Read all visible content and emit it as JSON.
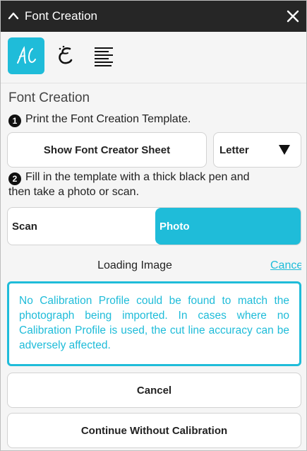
{
  "window": {
    "title": "Font Creation",
    "collapse_icon": "chevron-up-icon",
    "close_icon": "close-icon"
  },
  "tools": [
    {
      "name": "handwriting-tool-icon",
      "active": true
    },
    {
      "name": "calligraphy-tool-icon",
      "active": false
    },
    {
      "name": "text-align-tool-icon",
      "active": false
    }
  ],
  "section_title": "Font Creation",
  "step1": {
    "number": "1",
    "text": "Print the Font Creation Template."
  },
  "show_sheet_label": "Show Font Creator Sheet",
  "paper_size": {
    "selected": "Letter"
  },
  "step2": {
    "number": "2",
    "line1": "Fill in the template with a thick black pen and",
    "line2": "then take a photo or scan."
  },
  "source_toggle": {
    "scan_label": "Scan",
    "photo_label": "Photo",
    "selected": "Photo"
  },
  "status_text": "Loading Image",
  "cancel_link": "Cancel",
  "alert_text": "No Calibration Profile could be found to match the photograph being imported. In cases where no Calibration Profile is used, the cut line accuracy can be adversely affected.",
  "buttons": {
    "cancel": "Cancel",
    "continue": "Continue Without Calibration"
  },
  "colors": {
    "accent": "#1fbcd9",
    "titlebar": "#262626"
  }
}
